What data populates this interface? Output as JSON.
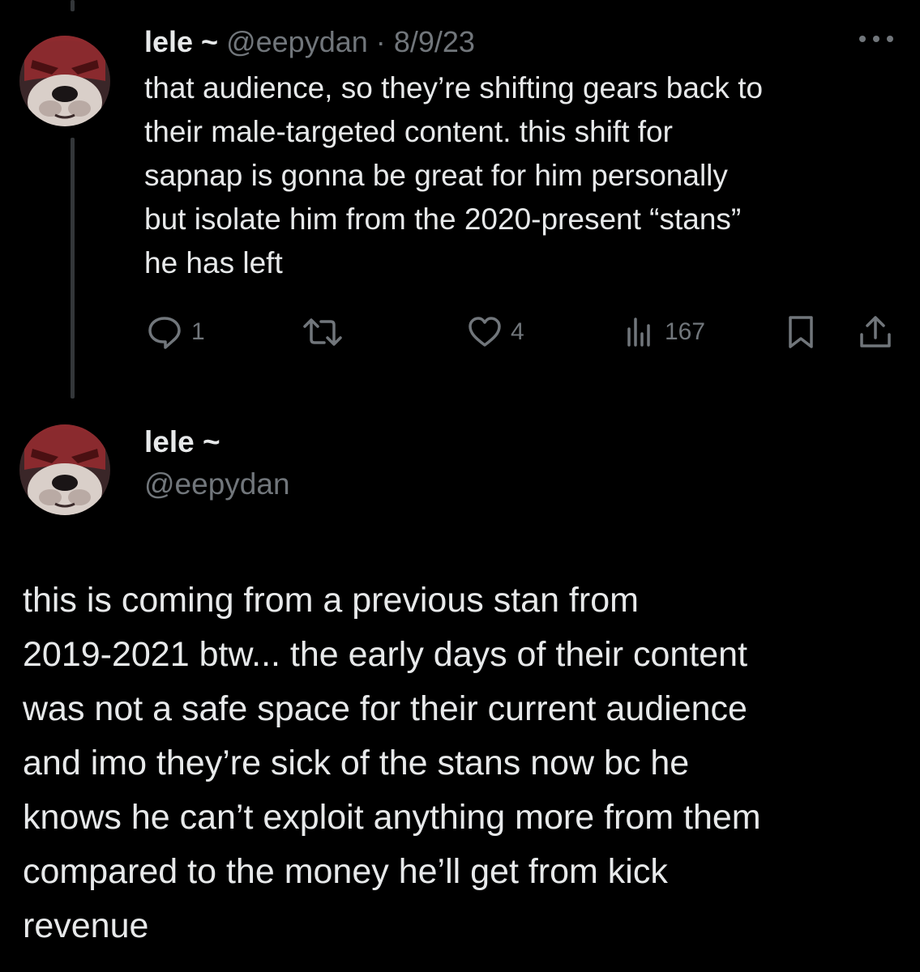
{
  "tweet1": {
    "name": "lele ~",
    "handle": "@eepydan",
    "separator": "·",
    "date": "8/9/23",
    "lines": [
      "that audience, so they’re shifting gears back to",
      "their male-targeted content. this shift for",
      "sapnap is gonna be great for him personally",
      "but isolate him from the 2020-present “stans”",
      "he has left"
    ],
    "actions": {
      "reply_count": "1",
      "retweet_count": "",
      "like_count": "4",
      "view_count": "167"
    },
    "icons": [
      "more-icon",
      "reply-icon",
      "retweet-icon",
      "like-icon",
      "views-icon",
      "bookmark-icon",
      "share-icon"
    ]
  },
  "tweet2": {
    "name": "lele ~",
    "handle": "@eepydan",
    "lines": [
      "this is coming from a previous stan from",
      "2019-2021 btw... the early days of their content",
      "was not a safe space for their current audience",
      "and imo they’re sick of the stans now bc he",
      "knows he can’t exploit anything more from them",
      "compared to the money he’ll get from kick",
      "revenue"
    ]
  },
  "colors": {
    "background": "#000000",
    "text_primary": "#e7e9ea",
    "text_secondary": "#71767b",
    "thread_line": "#333639",
    "avatar_mask": "#8e2a2e"
  }
}
